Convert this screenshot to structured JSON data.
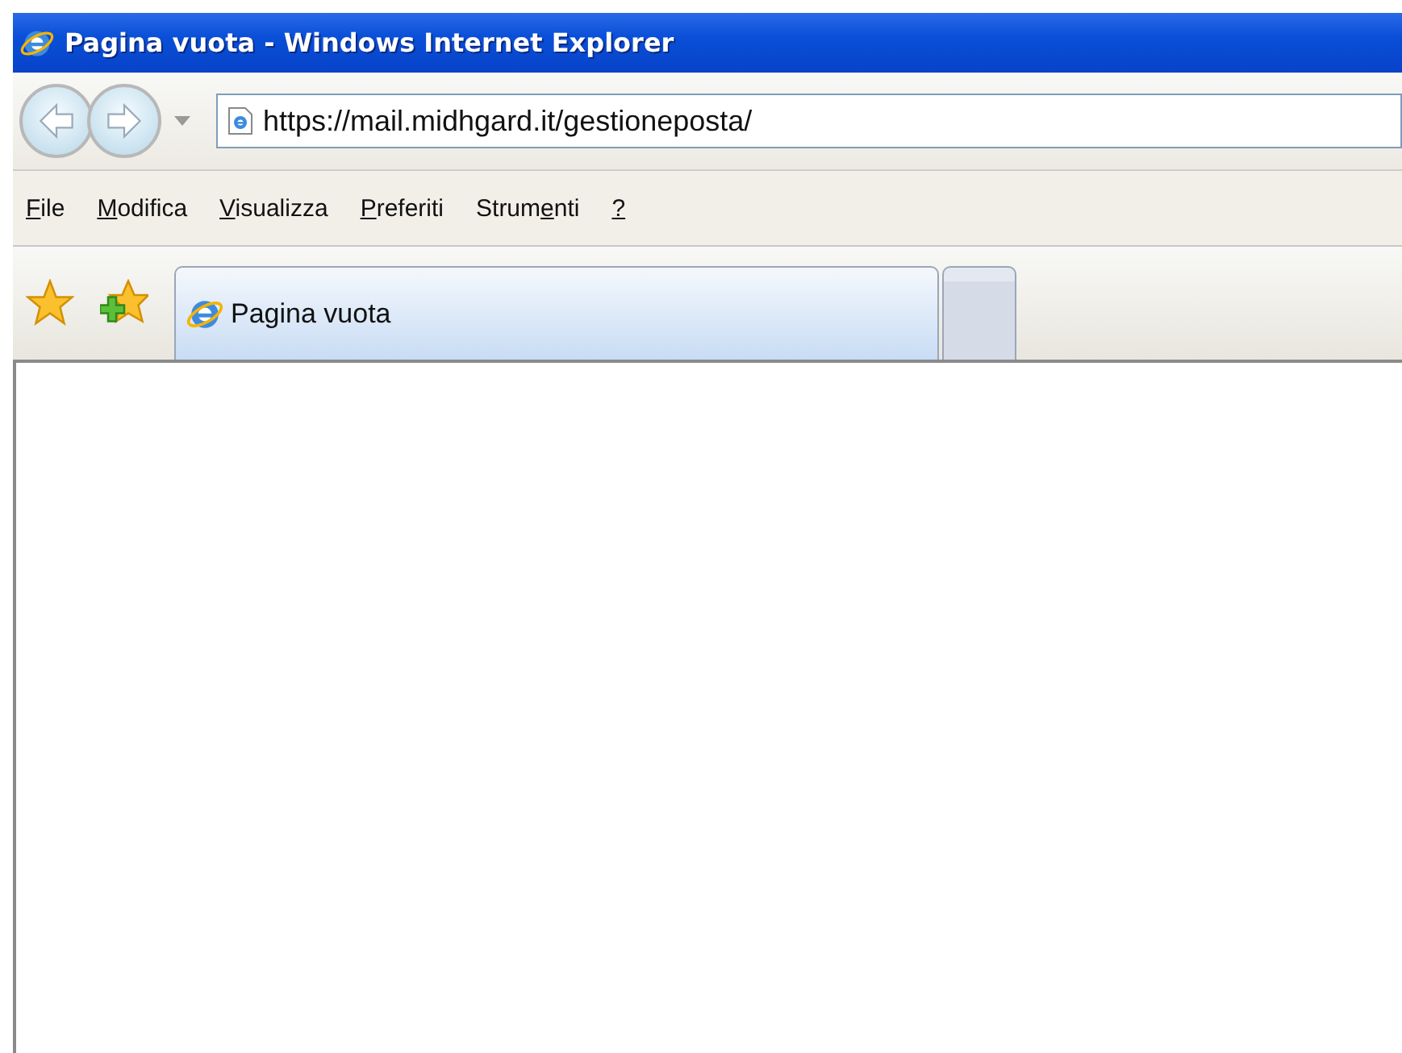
{
  "window": {
    "title": "Pagina vuota - Windows Internet Explorer"
  },
  "address_bar": {
    "value": "https://mail.midhgard.it/gestioneposta/"
  },
  "menu": [
    {
      "key": "F",
      "after": "ile"
    },
    {
      "key": "M",
      "after": "odifica"
    },
    {
      "key": "V",
      "after": "isualizza"
    },
    {
      "key": "P",
      "after": "referiti"
    },
    {
      "before": "Strum",
      "key": "e",
      "after": "nti"
    },
    {
      "key": "?"
    }
  ],
  "tabs": [
    {
      "label": "Pagina vuota",
      "selected": true
    },
    {
      "kind": "new",
      "selected": false
    }
  ]
}
